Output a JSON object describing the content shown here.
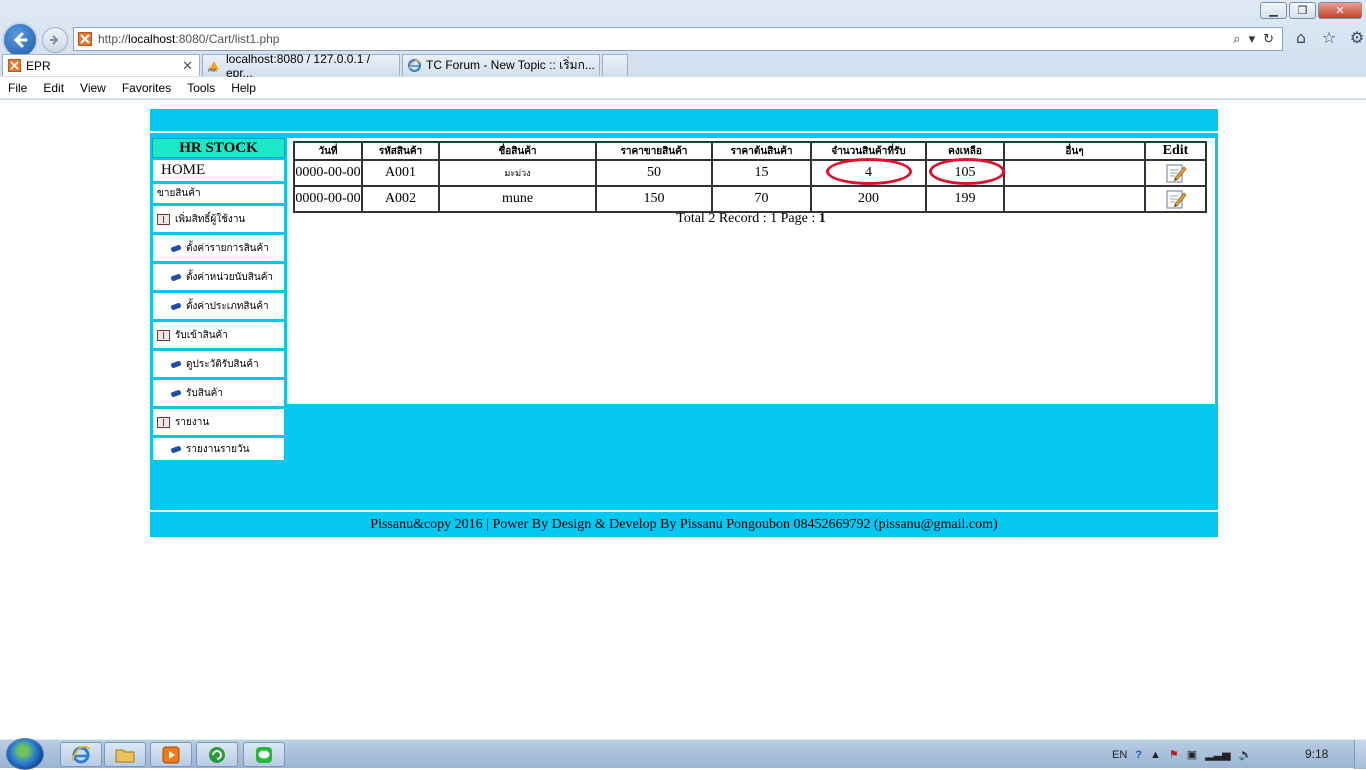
{
  "browser": {
    "url_prefix": "http://",
    "url_host": "localhost",
    "url_rest": ":8080/Cart/list1.php",
    "tabs": [
      {
        "label": "EPR",
        "active": true
      },
      {
        "label": "localhost:8080 / 127.0.0.1 / epr...",
        "active": false
      },
      {
        "label": "TC Forum - New Topic :: เริ่มก...",
        "active": false
      }
    ],
    "menu": [
      "File",
      "Edit",
      "View",
      "Favorites",
      "Tools",
      "Help"
    ],
    "colors": {
      "page_bg": "#05c8f0",
      "sidebar_title_bg": "#1be8c8",
      "highlight_ring": "#e0102a"
    }
  },
  "sidebar": {
    "title": "HR STOCK",
    "home": "HOME",
    "items": [
      {
        "label": "ขายสินค้า",
        "icon": "none",
        "level": 0
      },
      {
        "label": "เพิ่มสิทธิ์ผู้ใช้งาน",
        "icon": "book-icon",
        "level": 0
      },
      {
        "label": "ตั้งค่ารายการสินค้า",
        "icon": "pen-icon",
        "level": 1
      },
      {
        "label": "ตั้งค่าหน่วยนับสินค้า",
        "icon": "pen-icon",
        "level": 1
      },
      {
        "label": "ตั้งค่าประเภทสินค้า",
        "icon": "pen-icon",
        "level": 1
      },
      {
        "label": "รับเข้าสินค้า",
        "icon": "book-icon",
        "level": 0
      },
      {
        "label": "ดูประวัติรับสินค้า",
        "icon": "pen-icon",
        "level": 1
      },
      {
        "label": "รับสินค้า",
        "icon": "pen-icon",
        "level": 1
      },
      {
        "label": "รายงาน",
        "icon": "book-icon",
        "level": 0
      },
      {
        "label": "รายงานรายวัน",
        "icon": "pen-icon",
        "level": 1
      }
    ]
  },
  "table": {
    "headers": [
      "วันที่",
      "รหัสสินค้า",
      "ชื่อสินค้า",
      "ราคาขายสินค้า",
      "ราคาต้นสินค้า",
      "จำนวนสินค้าที่รับ",
      "คงเหลือ",
      "อื่นๆ",
      "Edit"
    ],
    "rows": [
      [
        "0000-00-00",
        "A001",
        "มะม่วง",
        "50",
        "15",
        "4",
        "105",
        ""
      ],
      [
        "0000-00-00",
        "A002",
        "mune",
        "150",
        "70",
        "200",
        "199",
        ""
      ]
    ]
  },
  "totals": {
    "text": "Total 2 Record : 1 Page : ",
    "page": "1"
  },
  "footer": "Pissanu&copy 2016 | Power By Design & Develop By Pissanu Pongoubon 08452669792 (pissanu@gmail.com)",
  "taskbar": {
    "language": "EN",
    "clock": "9:18"
  }
}
